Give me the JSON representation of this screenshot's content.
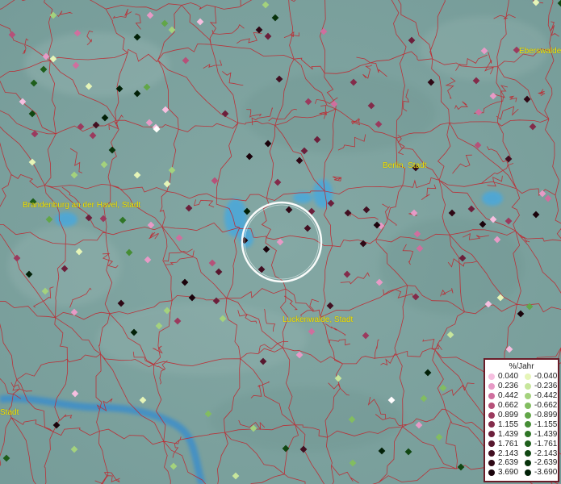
{
  "map": {
    "places": [
      {
        "id": "eberswalde",
        "label": "Eberswalde"
      },
      {
        "id": "berlin",
        "label": "Berlin, Stadt"
      },
      {
        "id": "brandenburg",
        "label": "Brandenburg an der Havel, Stadt"
      },
      {
        "id": "luckenwalde",
        "label": "Luckenwalde, Stadt"
      },
      {
        "id": "partial",
        "label": "Stadt"
      }
    ],
    "colors": {
      "background": "#7fa3a0",
      "boundaries": "#c0262d",
      "water": "#4aa8dc",
      "selection_circle": "#ffffff"
    }
  },
  "legend": {
    "title": "%/Jahr",
    "positive": [
      {
        "value": "0.040",
        "color": "#f6bfe0"
      },
      {
        "value": "0.236",
        "color": "#e79ac6"
      },
      {
        "value": "0.442",
        "color": "#cf6f9e"
      },
      {
        "value": "0.662",
        "color": "#b65179"
      },
      {
        "value": "0.899",
        "color": "#9b3a5e"
      },
      {
        "value": "1.155",
        "color": "#832b4a"
      },
      {
        "value": "1.439",
        "color": "#6c1f3b"
      },
      {
        "value": "1.761",
        "color": "#57172e"
      },
      {
        "value": "2.143",
        "color": "#420f21"
      },
      {
        "value": "2.639",
        "color": "#2f0815"
      },
      {
        "value": "3.690",
        "color": "#1a030b"
      }
    ],
    "negative": [
      {
        "value": "-0.040",
        "color": "#e6f5b8"
      },
      {
        "value": "-0.236",
        "color": "#c7e69c"
      },
      {
        "value": "-0.442",
        "color": "#a4d27d"
      },
      {
        "value": "-0.662",
        "color": "#82bd60"
      },
      {
        "value": "-0.899",
        "color": "#62a648"
      },
      {
        "value": "-1.155",
        "color": "#468d35"
      },
      {
        "value": "-1.439",
        "color": "#2f7526"
      },
      {
        "value": "-1.761",
        "color": "#1e5e1b"
      },
      {
        "value": "-2.143",
        "color": "#114712"
      },
      {
        "value": "-2.639",
        "color": "#08320b"
      },
      {
        "value": "-3.690",
        "color": "#022007"
      }
    ]
  }
}
